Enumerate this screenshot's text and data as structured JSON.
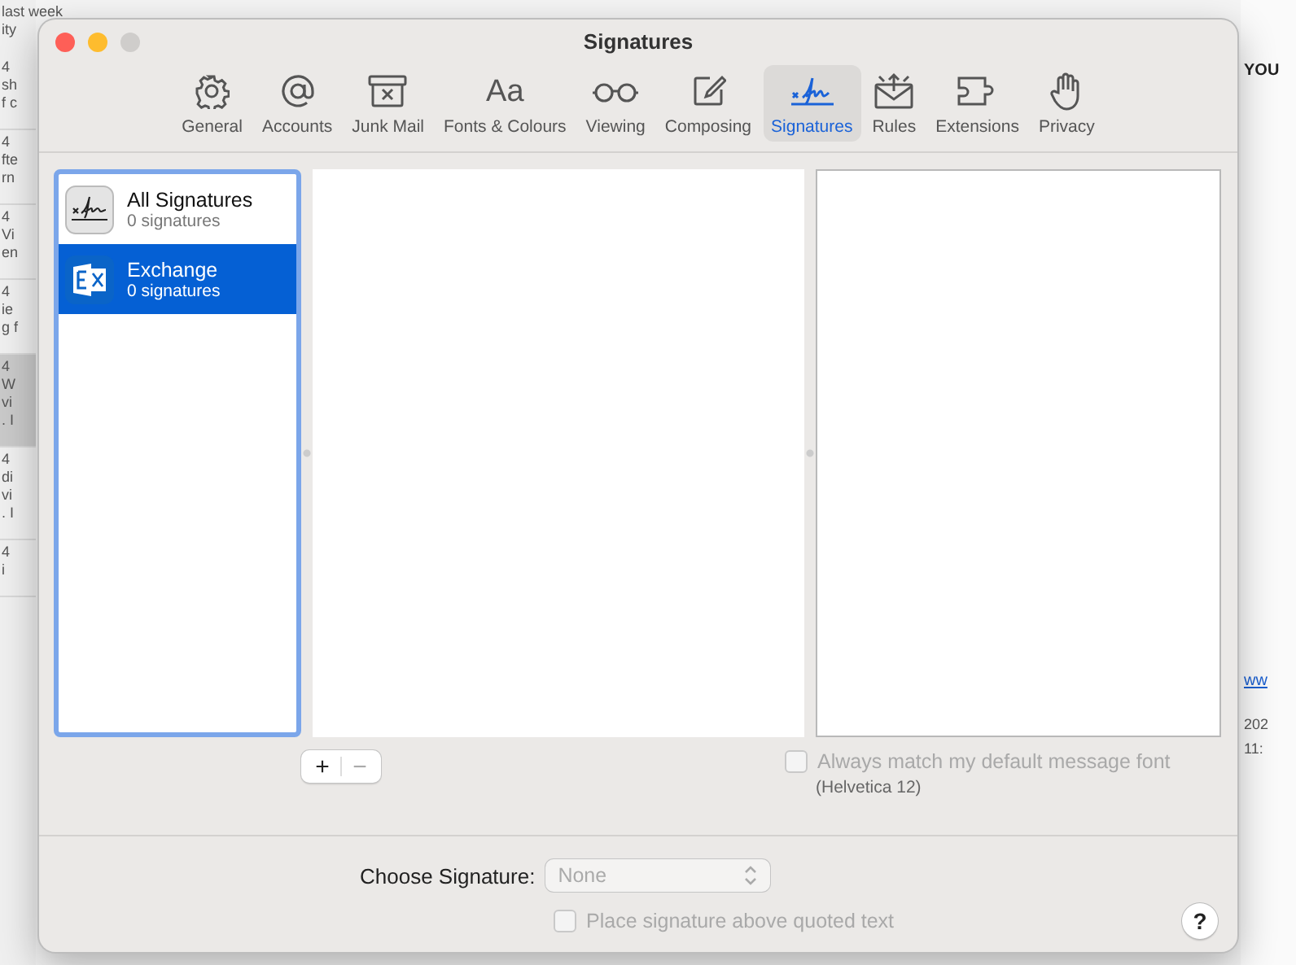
{
  "background": {
    "left_rows": [
      {
        "lines": [
          "last week",
          "ity"
        ],
        "selected": false
      },
      {
        "lines": [
          "4",
          "sh",
          "f c"
        ],
        "selected": false
      },
      {
        "lines": [
          "4",
          "fte",
          "rn"
        ],
        "selected": false
      },
      {
        "lines": [
          "4",
          "Vi",
          "en"
        ],
        "selected": false
      },
      {
        "lines": [
          "4",
          "ie",
          "g f"
        ],
        "selected": false
      },
      {
        "lines": [
          "4",
          "W",
          "vi",
          ". I"
        ],
        "selected": true
      },
      {
        "lines": [
          "4",
          "di",
          "vi",
          ". I"
        ],
        "selected": false
      },
      {
        "lines": [
          "4",
          "i"
        ],
        "selected": false
      }
    ],
    "right_heading": "YOU",
    "right_link": "ww",
    "right_lines": [
      "202",
      "11:"
    ]
  },
  "window": {
    "title": "Signatures"
  },
  "tabs": [
    {
      "label": "General",
      "kind": "gear",
      "selected": false
    },
    {
      "label": "Accounts",
      "kind": "at",
      "selected": false
    },
    {
      "label": "Junk Mail",
      "kind": "junk",
      "selected": false
    },
    {
      "label": "Fonts & Colours",
      "kind": "glyph",
      "glyph": "Aa",
      "selected": false
    },
    {
      "label": "Viewing",
      "kind": "glasses",
      "selected": false
    },
    {
      "label": "Composing",
      "kind": "compose",
      "selected": false
    },
    {
      "label": "Signatures",
      "kind": "signature",
      "selected": true
    },
    {
      "label": "Rules",
      "kind": "rules",
      "selected": false
    },
    {
      "label": "Extensions",
      "kind": "puzzle",
      "selected": false
    },
    {
      "label": "Privacy",
      "kind": "hand",
      "selected": false
    }
  ],
  "accounts": [
    {
      "name": "All Signatures",
      "count": "0 signatures",
      "kind": "all",
      "selected": false
    },
    {
      "name": "Exchange",
      "count": "0 signatures",
      "kind": "exchange",
      "selected": true
    }
  ],
  "segmented": [
    {
      "label": "+",
      "disabled": false
    },
    {
      "label": "−",
      "disabled": true
    }
  ],
  "match_font": {
    "label": "Always match my default message font",
    "checked": false,
    "disabled": true,
    "note": "(Helvetica 12)"
  },
  "choose_signature": {
    "label": "Choose Signature:",
    "value": "None",
    "disabled": true
  },
  "place_above": {
    "label": "Place signature above quoted text",
    "checked": false,
    "disabled": true
  },
  "help": "?"
}
